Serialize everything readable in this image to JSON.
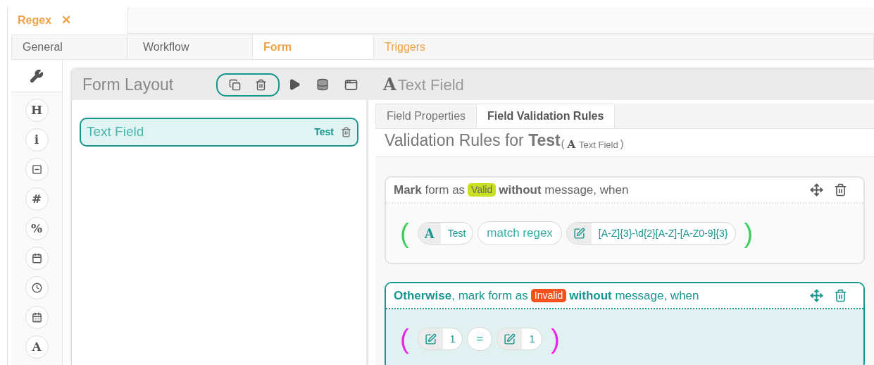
{
  "document_tab": {
    "title": "Regex",
    "close": "✕"
  },
  "tabs": [
    {
      "label": "General",
      "selected": false
    },
    {
      "label": "Workflow",
      "selected": false
    },
    {
      "label": "Form",
      "selected": true
    },
    {
      "label": "Triggers",
      "selected": false
    }
  ],
  "toolbox": [
    {
      "kind": "glyph",
      "text": "H"
    },
    {
      "kind": "glyph",
      "text": "i"
    },
    {
      "kind": "icon"
    },
    {
      "kind": "glyph",
      "text": "#"
    },
    {
      "kind": "glyph",
      "text": "%"
    },
    {
      "kind": "icon"
    },
    {
      "kind": "icon"
    },
    {
      "kind": "icon"
    },
    {
      "kind": "glyph",
      "text": "A"
    }
  ],
  "form_layout": {
    "title": "Form Layout",
    "items": [
      {
        "label": "Text Field",
        "name": "Test",
        "selected": true
      }
    ]
  },
  "field_editor": {
    "type_glyph": "A",
    "title": "Text Field",
    "tabs": [
      {
        "label": "Field Properties",
        "selected": false
      },
      {
        "label": "Field Validation Rules",
        "selected": true
      }
    ],
    "heading": "Validation Rules for **Test**",
    "heading_open": "(",
    "heading_glyph": "A",
    "heading_type": "Text Field",
    "heading_close": ")",
    "rules": [
      {
        "selected": false,
        "prefix": "**Mark** form as",
        "badge": "Valid",
        "color": "#c8e021",
        "suffix": "**without** message, when",
        "group": {
          "open": "(",
          "close": ")",
          "color": "#3ccf5e",
          "terms": [
            {
              "kind": "field",
              "glyph": "A",
              "value": "Test"
            },
            {
              "kind": "operator",
              "value": "match regex"
            },
            {
              "kind": "literal",
              "value": "[A-Z]{3}-\\d{2}[A-Z]-[A-Z0-9]{3}"
            }
          ]
        }
      },
      {
        "selected": true,
        "prefix": "**Otherwise**, mark form as",
        "badge": "Invalid",
        "color": "#f4511e",
        "suffix": "**without** message, when",
        "group": {
          "open": "(",
          "close": ")",
          "color": "#ee22ee",
          "terms": [
            {
              "kind": "literal",
              "value": "1"
            },
            {
              "kind": "operator",
              "value": "="
            },
            {
              "kind": "literal",
              "value": "1"
            }
          ]
        }
      }
    ]
  }
}
